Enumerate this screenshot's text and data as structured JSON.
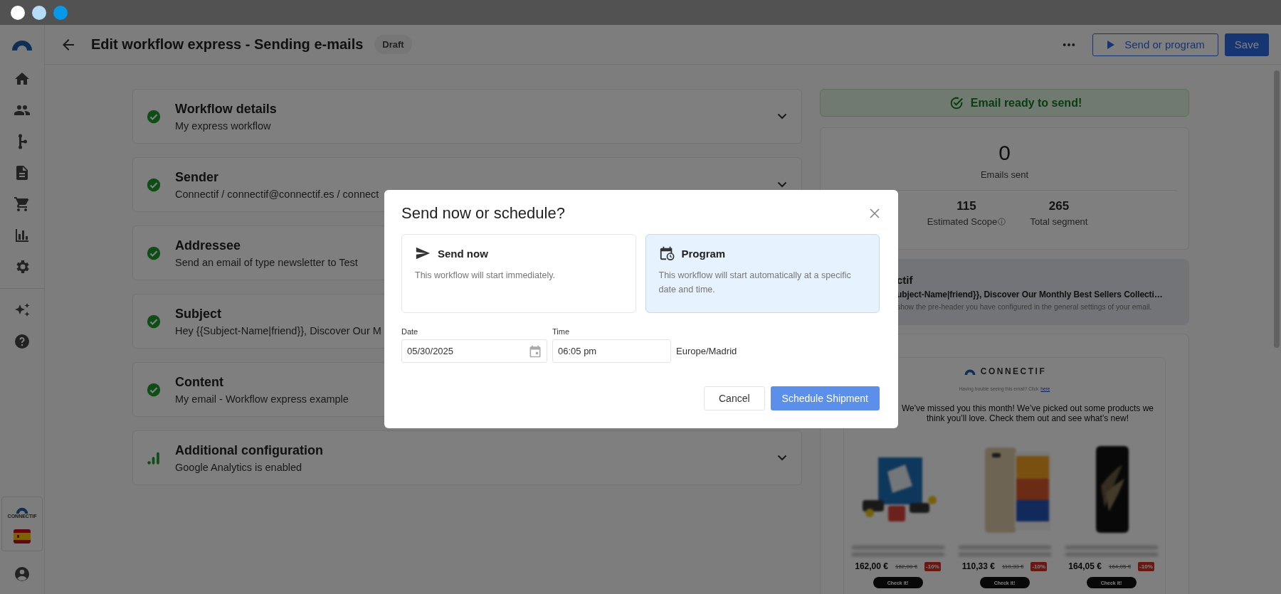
{
  "window": {
    "controls": [
      {
        "color": "#ffffff"
      },
      {
        "color": "#b5ddf8"
      },
      {
        "color": "#0898ea"
      }
    ]
  },
  "sidebar": {
    "brand_text": "CONNECTIF"
  },
  "header": {
    "title": "Edit workflow express - Sending e-mails",
    "status": "Draft",
    "send_button": "Send or program",
    "save_button": "Save"
  },
  "steps": [
    {
      "kind": "check",
      "title": "Workflow details",
      "subtitle": "My express workflow"
    },
    {
      "kind": "check",
      "title": "Sender",
      "subtitle": "Connectif / connectif@connectif.es / connect"
    },
    {
      "kind": "check",
      "title": "Addressee",
      "subtitle": "Send an email of type newsletter to Test"
    },
    {
      "kind": "check",
      "title": "Subject",
      "subtitle": "Hey {{Subject-Name|friend}}, Discover Our M"
    },
    {
      "kind": "check",
      "title": "Content",
      "subtitle": "My email - Workflow express example"
    },
    {
      "kind": "analytics",
      "title": "Additional configuration",
      "subtitle": "Google Analytics is enabled"
    }
  ],
  "summary": {
    "banner": "Email ready to send!",
    "main_stat": {
      "value": "0",
      "label": "Emails sent"
    },
    "stats": [
      {
        "value": "115",
        "label": "Estimated Scope",
        "info": true
      },
      {
        "value": "265",
        "label": "Total segment",
        "info": false
      }
    ],
    "email": {
      "sender": "ctif",
      "subject": "ubject-Name|friend}}, Discover Our Monthly Best Sellers Collecti…",
      "preheader": "show the pre-header you have configured in the general settings of your email."
    },
    "preview": {
      "logo_text": "CONNECTIF",
      "trouble_text": "Having trouble seeing this email? Click",
      "trouble_link": "here",
      "message": "We've missed you this month! We’ve picked out some products we think you’ll love. Check them out and see what’s new!",
      "products": [
        {
          "price": "162,00 €",
          "old_price": "162,00 €",
          "discount": "-10%",
          "button": "Check it!"
        },
        {
          "price": "110,33 €",
          "old_price": "110,33 €",
          "discount": "-10%",
          "button": "Check it!"
        },
        {
          "price": "164,05 €",
          "old_price": "164,05 €",
          "discount": "-10%",
          "button": "Check it!"
        }
      ]
    }
  },
  "dialog": {
    "title": "Send now or schedule?",
    "options": [
      {
        "kind": "send",
        "title": "Send now",
        "description": "This workflow will start immediately.",
        "selected": false
      },
      {
        "kind": "program",
        "title": "Program",
        "description": "This workflow will start automatically at a specific date and time.",
        "selected": true
      }
    ],
    "date": {
      "label": "Date",
      "value": "05/30/2025"
    },
    "time": {
      "label": "Time",
      "value": "06:05 pm"
    },
    "timezone": "Europe/Madrid",
    "cancel": "Cancel",
    "confirm": "Schedule Shipment"
  }
}
